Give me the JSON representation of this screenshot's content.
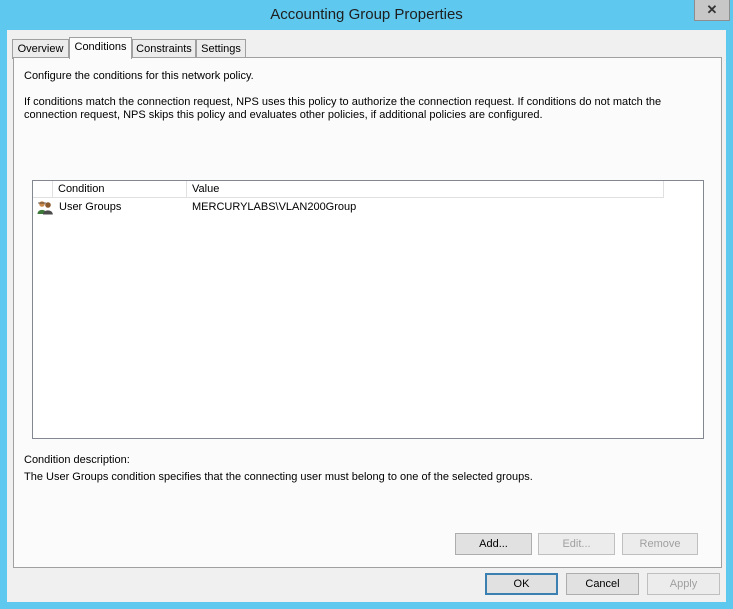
{
  "window": {
    "title": "Accounting Group Properties",
    "close_glyph": "✕"
  },
  "tabs": [
    {
      "label": "Overview"
    },
    {
      "label": "Conditions"
    },
    {
      "label": "Constraints"
    },
    {
      "label": "Settings"
    }
  ],
  "conditions": {
    "intro": "Configure the conditions for this network policy.",
    "desc_line1": "If conditions match the connection request, NPS uses this policy to authorize the connection request. If conditions do not match the",
    "desc_line2": "connection request, NPS skips this policy and evaluates other policies, if additional policies are configured.",
    "columns": {
      "condition": "Condition",
      "value": "Value"
    },
    "rows": [
      {
        "condition": "User Groups",
        "value": "MERCURYLABS\\VLAN200Group",
        "icon": "user-group-icon"
      }
    ],
    "condition_description_label": "Condition description:",
    "condition_description_text": "The User Groups condition specifies that the connecting user must belong to one of the selected groups.",
    "buttons": {
      "add": "Add...",
      "edit": "Edit...",
      "remove": "Remove"
    }
  },
  "dialog_buttons": {
    "ok": "OK",
    "cancel": "Cancel",
    "apply": "Apply"
  },
  "colors": {
    "frame": "#5ec8ef",
    "client": "#f0f0f0",
    "panel": "#fbfbfb",
    "default_button_border": "#3c7fb1"
  }
}
